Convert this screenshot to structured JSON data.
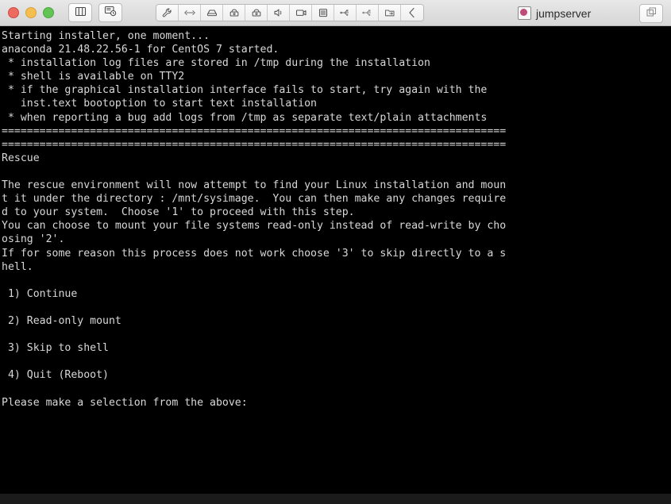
{
  "window": {
    "title": "jumpserver",
    "app_icon": "jumpserver-app-icon",
    "traffic_lights": [
      {
        "name": "close",
        "color": "#ec6a5e"
      },
      {
        "name": "minimize",
        "color": "#f4bf4f"
      },
      {
        "name": "maximize",
        "color": "#61c454"
      }
    ]
  },
  "toolbar": {
    "left_buttons": [
      {
        "name": "split-panes-button",
        "icon": "split-panes-icon"
      },
      {
        "name": "screen-timer-button",
        "icon": "screen-clock-icon"
      }
    ],
    "group_buttons": [
      {
        "name": "settings-button",
        "icon": "wrench-icon"
      },
      {
        "name": "resize-button",
        "icon": "horizontal-arrows-icon"
      },
      {
        "name": "disk-button",
        "icon": "disk-drive-icon"
      },
      {
        "name": "lock-button",
        "icon": "padlock-icon"
      },
      {
        "name": "secure-lock-button",
        "icon": "padlock-shield-icon"
      },
      {
        "name": "audio-button",
        "icon": "speaker-icon"
      },
      {
        "name": "video-button",
        "icon": "video-camera-icon"
      },
      {
        "name": "server-button",
        "icon": "server-stack-icon"
      },
      {
        "name": "usb-button",
        "icon": "usb-icon"
      },
      {
        "name": "usb2-button",
        "icon": "usb-icon"
      },
      {
        "name": "file-transfer-button",
        "icon": "folder-arrow-icon"
      },
      {
        "name": "collapse-button",
        "icon": "chevron-left-icon"
      }
    ],
    "right_button": {
      "name": "window-list-button",
      "icon": "duplicate-windows-icon"
    }
  },
  "terminal": {
    "lines": [
      "Starting installer, one moment...",
      "anaconda 21.48.22.56-1 for CentOS 7 started.",
      " * installation log files are stored in /tmp during the installation",
      " * shell is available on TTY2",
      " * if the graphical installation interface fails to start, try again with the",
      "   inst.text bootoption to start text installation",
      " * when reporting a bug add logs from /tmp as separate text/plain attachments",
      "================================================================================",
      "================================================================================",
      "Rescue",
      "",
      "The rescue environment will now attempt to find your Linux installation and moun",
      "t it under the directory : /mnt/sysimage.  You can then make any changes require",
      "d to your system.  Choose '1' to proceed with this step.",
      "You can choose to mount your file systems read-only instead of read-write by cho",
      "osing '2'.",
      "If for some reason this process does not work choose '3' to skip directly to a s",
      "hell.",
      "",
      " 1) Continue",
      "",
      " 2) Read-only mount",
      "",
      " 3) Skip to shell",
      "",
      " 4) Quit (Reboot)",
      "",
      "Please make a selection from the above:"
    ]
  }
}
